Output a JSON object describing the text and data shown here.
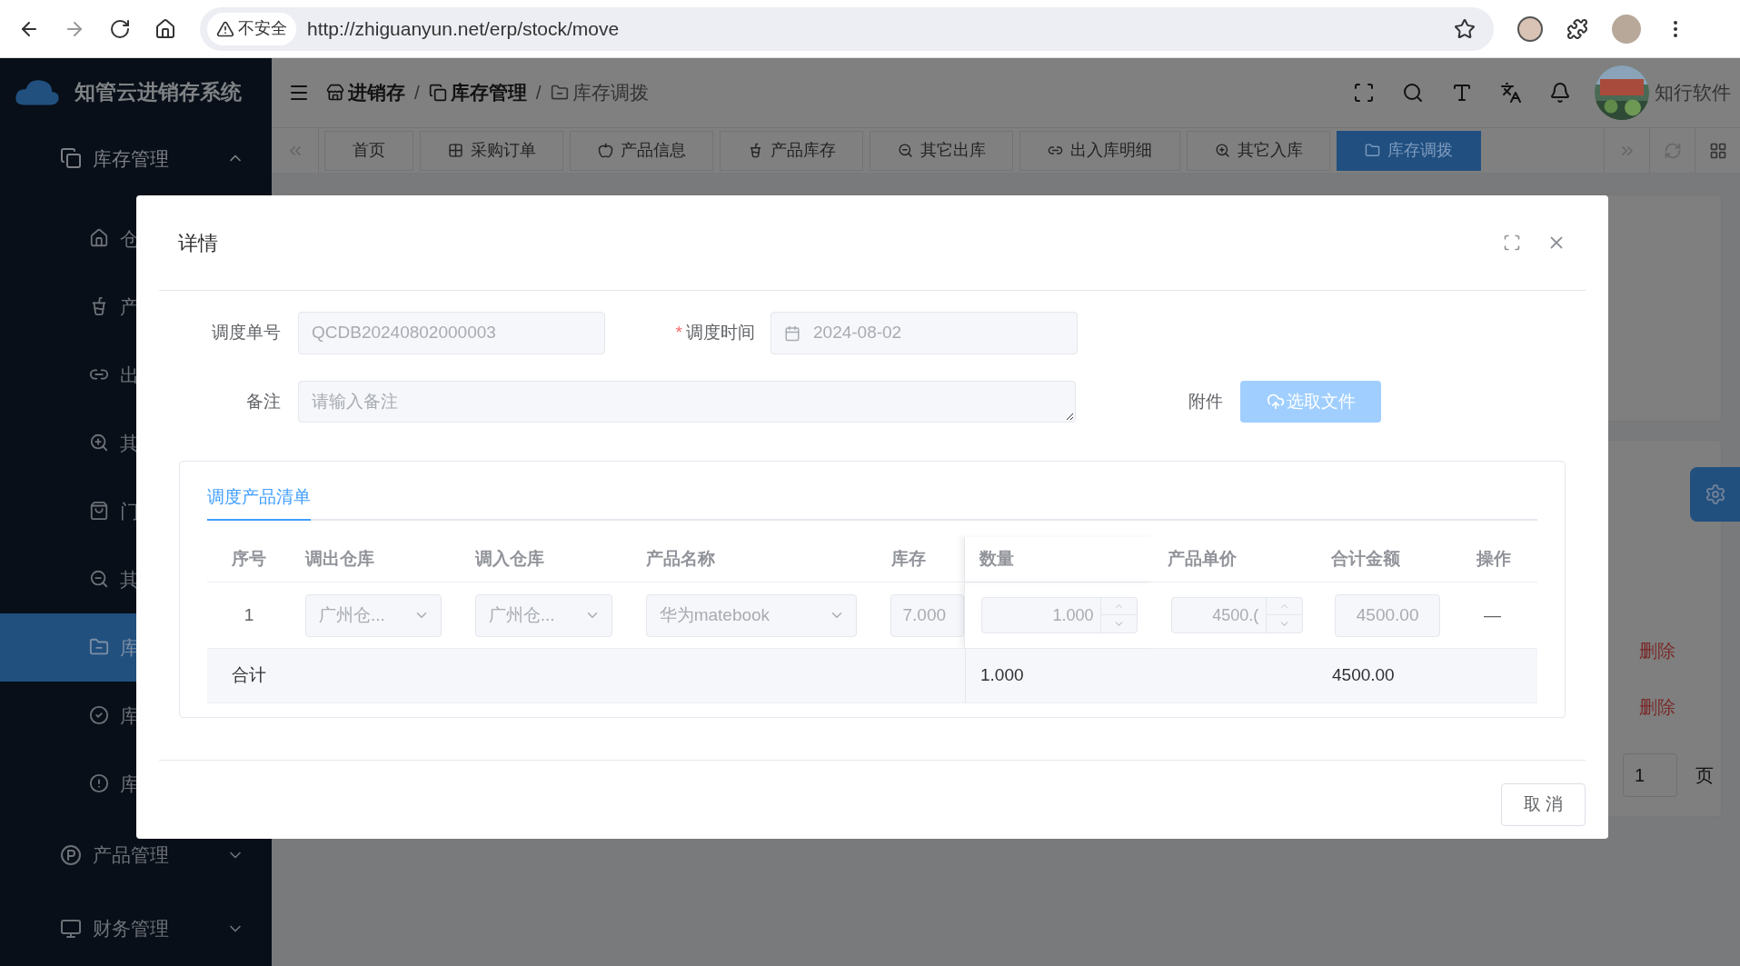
{
  "browser": {
    "warning": "不安全",
    "url": "http://zhiguanyun.net/erp/stock/move"
  },
  "app": {
    "title": "知管云进销存系统",
    "breadcrumb": [
      {
        "label": "进销存",
        "current": false
      },
      {
        "label": "库存管理",
        "current": false
      },
      {
        "label": "库存调拨",
        "current": true
      }
    ],
    "user": "知行软件",
    "separators": [
      "/",
      "/"
    ]
  },
  "sidebar": {
    "group": {
      "label": "库存管理",
      "expanded": true
    },
    "items": [
      {
        "label": "仓",
        "selected": false
      },
      {
        "label": "产",
        "selected": false
      },
      {
        "label": "出",
        "selected": false
      },
      {
        "label": "其",
        "selected": false
      },
      {
        "label": "门",
        "selected": false
      },
      {
        "label": "其",
        "selected": false
      },
      {
        "label": "库",
        "selected": true
      },
      {
        "label": "库",
        "selected": false
      },
      {
        "label": "库",
        "selected": false
      }
    ],
    "groups": [
      {
        "label": "产品管理",
        "expanded": false
      },
      {
        "label": "财务管理",
        "expanded": false
      }
    ]
  },
  "tabs": [
    {
      "label": "首页",
      "selected": false
    },
    {
      "label": "采购订单",
      "selected": false
    },
    {
      "label": "产品信息",
      "selected": false
    },
    {
      "label": "产品库存",
      "selected": false
    },
    {
      "label": "其它出库",
      "selected": false
    },
    {
      "label": "出入库明细",
      "selected": false
    },
    {
      "label": "其它入库",
      "selected": false
    },
    {
      "label": "库存调拨",
      "selected": true
    }
  ],
  "background": {
    "delete_links": [
      "删除",
      "删除"
    ],
    "page_input": "1",
    "page_label": "页"
  },
  "modal": {
    "title": "详情",
    "order_no": {
      "label": "调度单号",
      "value": "QCDB20240802000003",
      "disabled": true
    },
    "date": {
      "label": "调度时间",
      "required_mark": "*",
      "value": "2024-08-02",
      "disabled": true
    },
    "remark": {
      "label": "备注",
      "placeholder": "请输入备注",
      "disabled": true
    },
    "attachment": {
      "label": "附件",
      "button": "选取文件",
      "disabled": true
    },
    "card_tab": {
      "label": "调度产品清单",
      "selected": true
    },
    "columns": [
      "序号",
      "调出仓库",
      "调入仓库",
      "产品名称",
      "库存",
      "数量",
      "产品单价",
      "合计金额",
      "操作"
    ],
    "rows": [
      {
        "index": "1",
        "from": "广州仓...",
        "to": "广州仓...",
        "product": "华为matebook",
        "stock": "7.000",
        "qty": "1.000",
        "price": "4500.(",
        "amount": "4500.00",
        "action": "—",
        "disabled": true
      }
    ],
    "total": {
      "label": "合计",
      "qty": "1.000",
      "amount": "4500.00"
    },
    "cancel": "取 消"
  }
}
